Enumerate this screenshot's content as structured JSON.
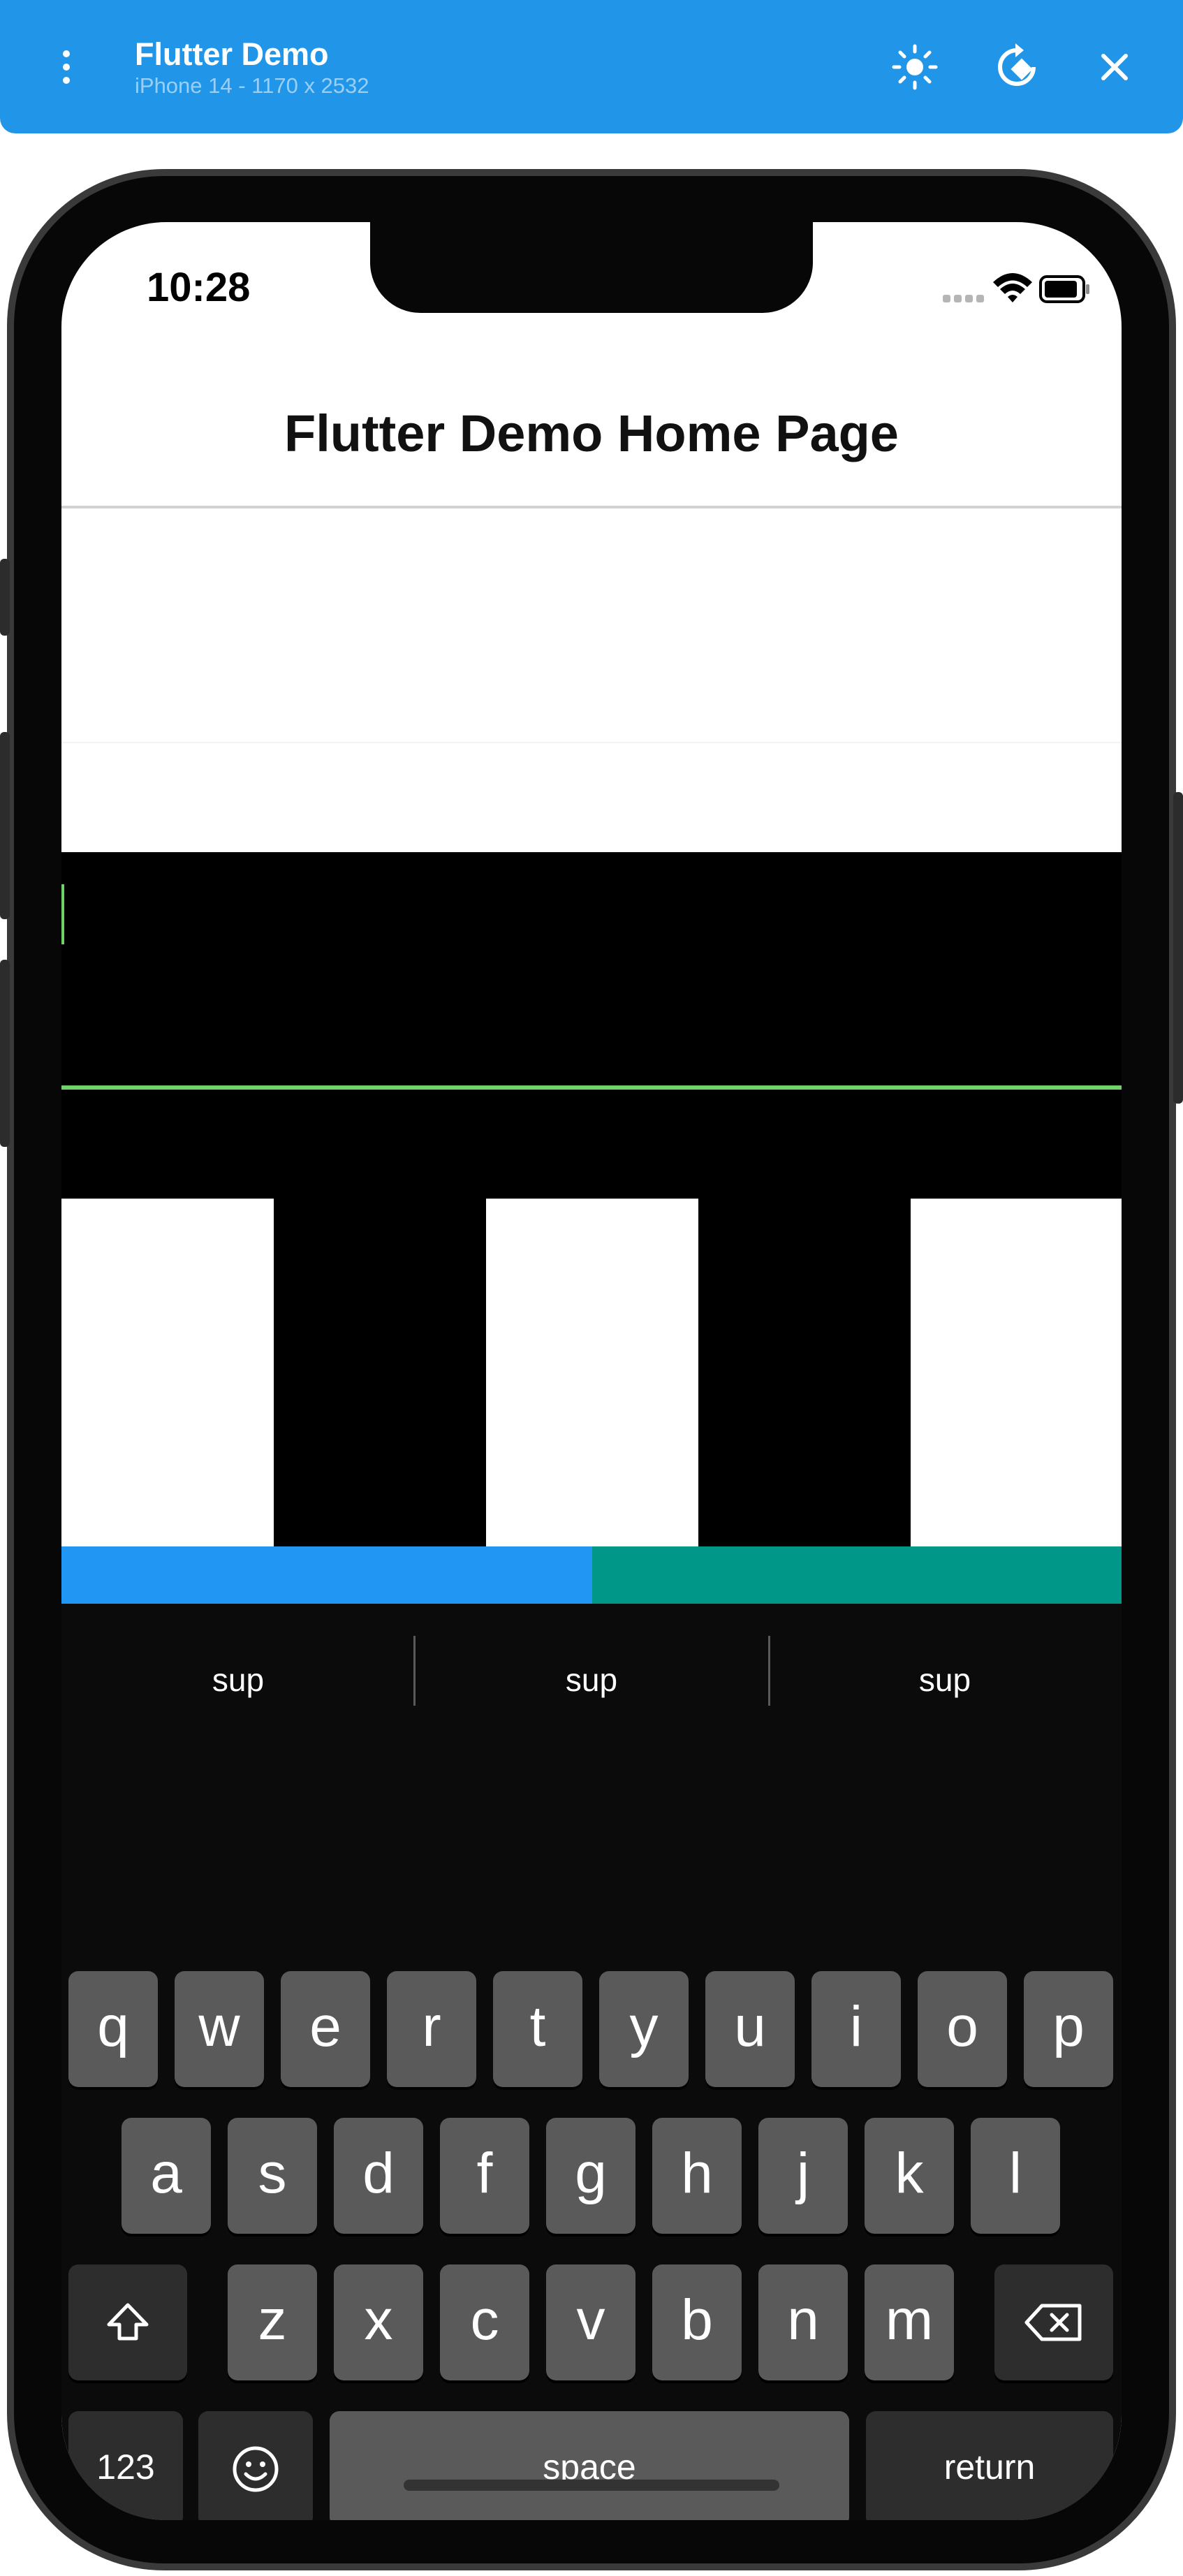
{
  "emulator": {
    "title": "Flutter Demo",
    "device": "iPhone 14 - 1170 x 2532",
    "buttons": [
      "brightness-icon",
      "rotate-icon",
      "close-icon"
    ]
  },
  "status_bar": {
    "time": "10:28"
  },
  "app": {
    "title": "Flutter Demo Home Page",
    "colors": {
      "blue": "#2196f3",
      "teal": "#009688",
      "green": "#6fd36a"
    }
  },
  "keyboard": {
    "suggestions": [
      "sup",
      "sup",
      "sup"
    ],
    "row1": [
      "q",
      "w",
      "e",
      "r",
      "t",
      "y",
      "u",
      "i",
      "o",
      "p"
    ],
    "row2": [
      "a",
      "s",
      "d",
      "f",
      "g",
      "h",
      "j",
      "k",
      "l"
    ],
    "row3": [
      "z",
      "x",
      "c",
      "v",
      "b",
      "n",
      "m"
    ],
    "numbers_label": "123",
    "space_label": "space",
    "return_label": "return"
  }
}
